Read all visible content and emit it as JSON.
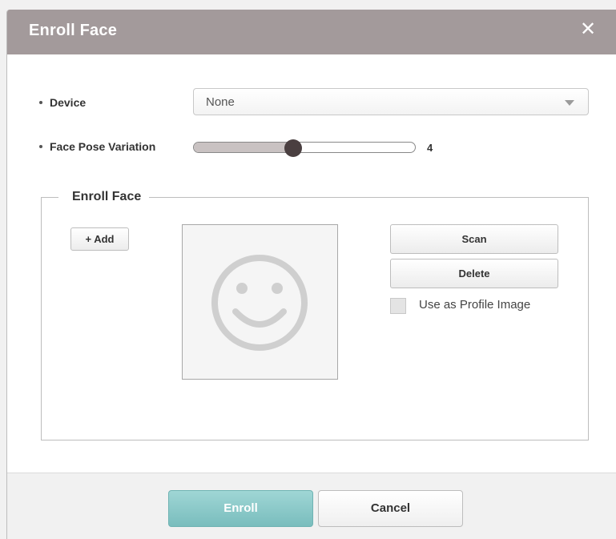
{
  "dialog": {
    "title": "Enroll Face",
    "close_icon": "close-icon"
  },
  "device": {
    "label": "Device",
    "selected": "None"
  },
  "pose": {
    "label": "Face Pose Variation",
    "value": "4",
    "level": 0.45
  },
  "enroll_section": {
    "legend": "Enroll Face",
    "add_label": "+ Add",
    "placeholder_icon": "smiley-face-icon",
    "scan_label": "Scan",
    "delete_label": "Delete",
    "profile_checkbox_label": "Use as Profile Image",
    "profile_checked": false
  },
  "footer": {
    "enroll_label": "Enroll",
    "cancel_label": "Cancel"
  },
  "colors": {
    "titlebar": "#a39a9b",
    "primary_button": "#88c7c6",
    "slider_thumb": "#4a3f40"
  }
}
